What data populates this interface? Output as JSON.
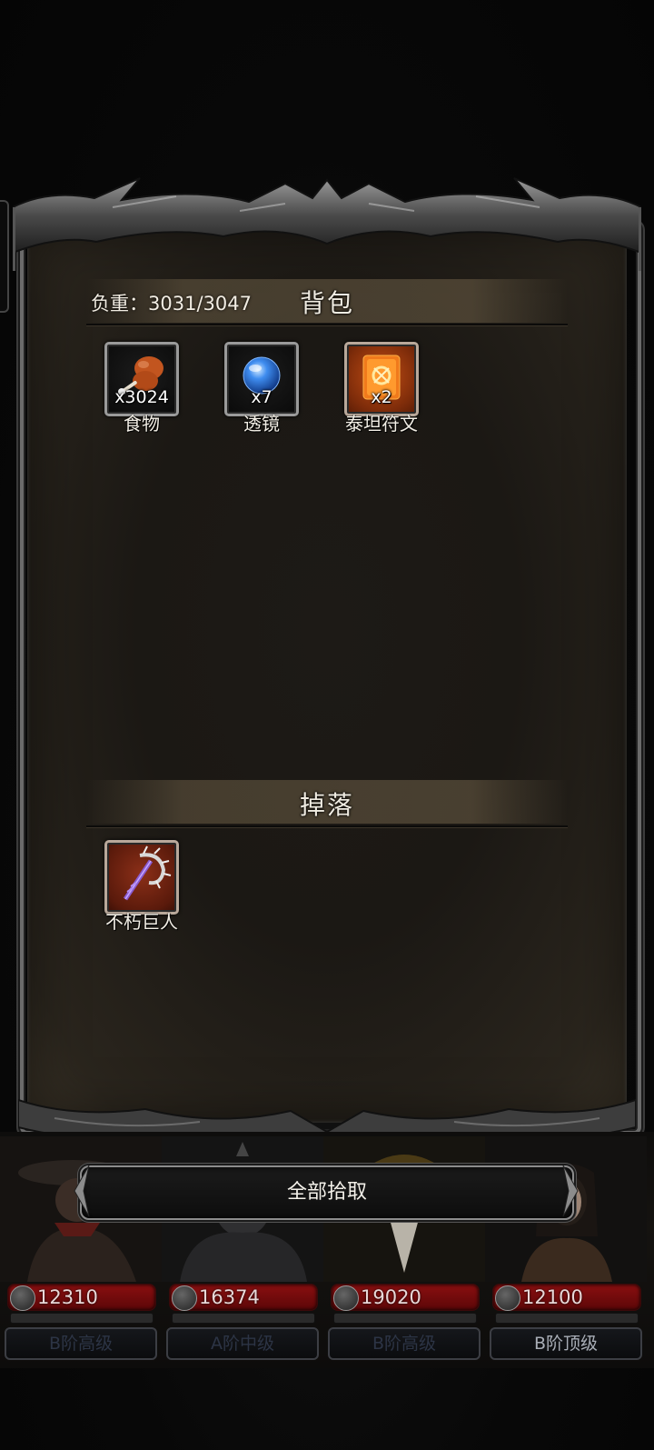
{
  "backpack": {
    "weight_text": "负重：3031/3047",
    "title": "背包",
    "items": [
      {
        "count": "x3024",
        "name": "食物",
        "icon": "drumstick-icon",
        "frame": "grey"
      },
      {
        "count": "x7",
        "name": "透镜",
        "icon": "blue-lens-icon",
        "frame": "grey"
      },
      {
        "count": "x2",
        "name": "泰坦符文",
        "icon": "titan-rune-icon",
        "frame": "orange"
      }
    ]
  },
  "drops": {
    "title": "掉落",
    "items": [
      {
        "name": "不朽巨人",
        "icon": "spiked-mace-icon",
        "frame": "red"
      }
    ]
  },
  "actions": {
    "pick_all_label": "全部拾取"
  },
  "heroes": [
    {
      "hp": "12310",
      "rank": "B阶高级",
      "rank_dim": true
    },
    {
      "hp": "16374",
      "rank": "A阶中级",
      "rank_dim": true
    },
    {
      "hp": "19020",
      "rank": "B阶高级",
      "rank_dim": true
    },
    {
      "hp": "12100",
      "rank": "B阶顶级",
      "rank_dim": false
    }
  ],
  "colors": {
    "panel_bg": "#1b1814",
    "frame_metal": "#6b6b6b",
    "hp_red": "#8a0f10",
    "rune_orange": "#c24e14"
  }
}
